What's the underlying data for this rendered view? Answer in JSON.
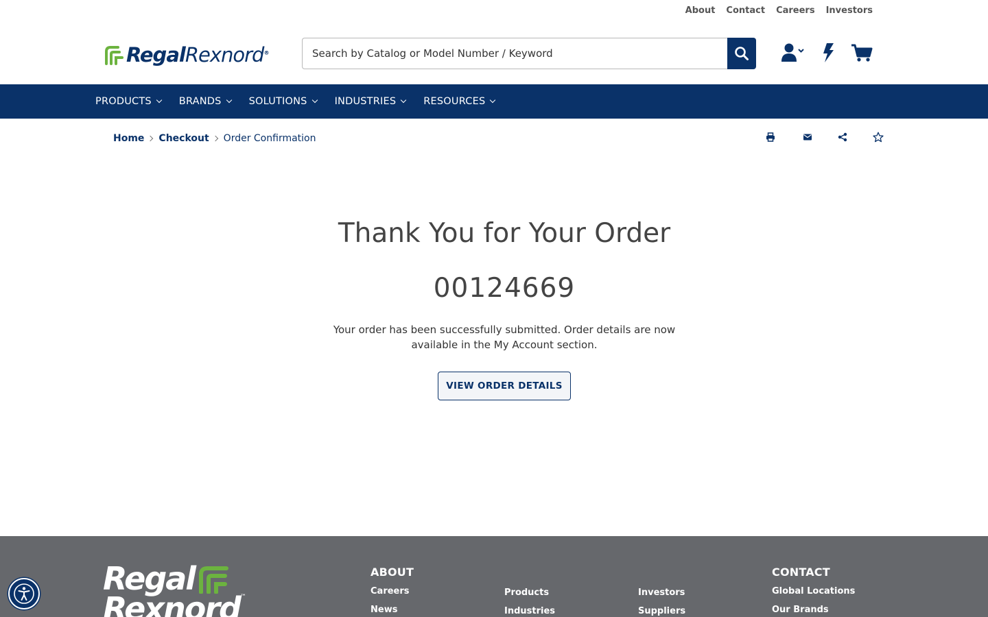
{
  "utility_links": [
    "About",
    "Contact",
    "Careers",
    "Investors"
  ],
  "brand": {
    "name_bold": "Regal",
    "name_light": "Rexnord",
    "tm": "®",
    "footer_line1": "Regal",
    "footer_line2": "Rexnord",
    "footer_tm": "™"
  },
  "search": {
    "placeholder": "Search by Catalog or Model Number / Keyword",
    "value": ""
  },
  "header_icons": [
    "user-icon",
    "bolt-icon",
    "cart-icon"
  ],
  "nav": [
    "PRODUCTS",
    "BRANDS",
    "SOLUTIONS",
    "INDUSTRIES",
    "RESOURCES"
  ],
  "breadcrumb": {
    "home": "Home",
    "checkout": "Checkout",
    "current": "Order Confirmation"
  },
  "page_tools": [
    "print-icon",
    "email-icon",
    "share-icon",
    "favorite-star-icon"
  ],
  "confirmation": {
    "title": "Thank You for Your Order",
    "order_number": "00124669",
    "message": "Your order has been successfully submitted. Order details are now available in the My Account section.",
    "button": "VIEW ORDER DETAILS"
  },
  "footer": {
    "about_heading": "ABOUT",
    "col1": [
      "Careers",
      "News"
    ],
    "col2": [
      "Products",
      "Industries"
    ],
    "col3": [
      "Investors",
      "Suppliers"
    ],
    "contact_heading": "CONTACT",
    "col4": [
      "Global Locations",
      "Our Brands"
    ]
  },
  "colors": {
    "primary": "#0a3269",
    "accent_green": "#6cb33f",
    "footer_bg": "#66686c"
  }
}
